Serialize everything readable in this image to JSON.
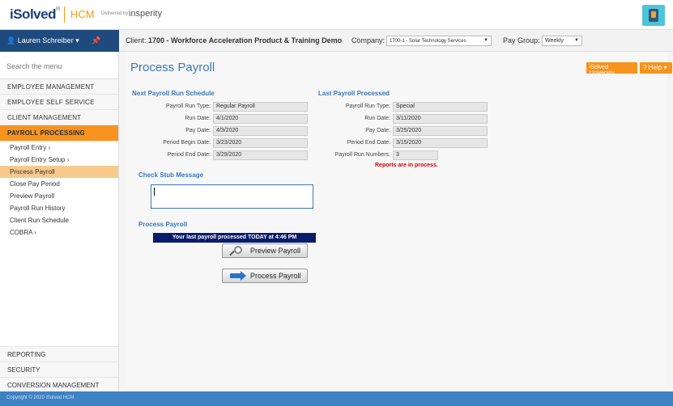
{
  "header": {
    "logo": "iSolved",
    "logo_suffix": "HCM",
    "delivered_by": "Delivered by",
    "partner": "insperity"
  },
  "userbar": {
    "user": "Lauren Schreiber ▾",
    "pin": "📌"
  },
  "clientbar": {
    "client_label": "Client:",
    "client_value": "1700 - Workforce Acceleration Product & Training Demo",
    "company_label": "Company:",
    "company_value": "1700-1 - Solar Technology Services",
    "paygroup_label": "Pay Group:",
    "paygroup_value": "Weekly"
  },
  "sidebar": {
    "search_placeholder": "Search the menu",
    "main_items": [
      "EMPLOYEE MANAGEMENT",
      "EMPLOYEE SELF SERVICE",
      "CLIENT MANAGEMENT",
      "PAYROLL PROCESSING"
    ],
    "sub_items": [
      "Payroll Entry  ›",
      "Payroll Entry Setup  ›",
      "Process Payroll",
      "Close Pay Period",
      "Preview Payroll",
      "Payroll Run History",
      "Client Run Schedule",
      "COBRA  ›"
    ],
    "bottom_items": [
      "REPORTING",
      "SECURITY",
      "CONVERSION MANAGEMENT"
    ]
  },
  "main": {
    "title": "Process Payroll",
    "university_btn": "iSolved University",
    "help_btn": "? Help ▾",
    "next_run": {
      "heading": "Next Payroll Run Schedule",
      "fields": [
        {
          "label": "Payroll Run Type:",
          "value": "Regular Payroll"
        },
        {
          "label": "Run Date:",
          "value": "4/1/2020"
        },
        {
          "label": "Pay Date:",
          "value": "4/3/2020"
        },
        {
          "label": "Period Begin Date:",
          "value": "3/23/2020"
        },
        {
          "label": "Period End Date:",
          "value": "3/29/2020"
        }
      ]
    },
    "last_run": {
      "heading": "Last Payroll Processed",
      "fields": [
        {
          "label": "Payroll Run Type:",
          "value": "Special"
        },
        {
          "label": "Run Date:",
          "value": "3/11/2020"
        },
        {
          "label": "Pay Date:",
          "value": "3/25/2020"
        },
        {
          "label": "Period End Date:",
          "value": "3/15/2020"
        },
        {
          "label": "Payroll Run Numbers:",
          "value": "3"
        }
      ],
      "warning": "Reports are in process."
    },
    "stub_heading": "Check Stub Message",
    "process_heading": "Process Payroll",
    "notice": "Your last payroll processed TODAY at 4:46 PM",
    "preview_btn": "Preview Payroll",
    "process_btn": "Process Payroll"
  },
  "footer": {
    "copyright": "Copyright © 2020 iSolved HCM"
  },
  "colors": {
    "brand_blue": "#1f4a7d",
    "accent_orange": "#f7931e",
    "title_blue": "#3a79b9",
    "notice_navy": "#0a1b6b",
    "warning_red": "#cc0000"
  }
}
